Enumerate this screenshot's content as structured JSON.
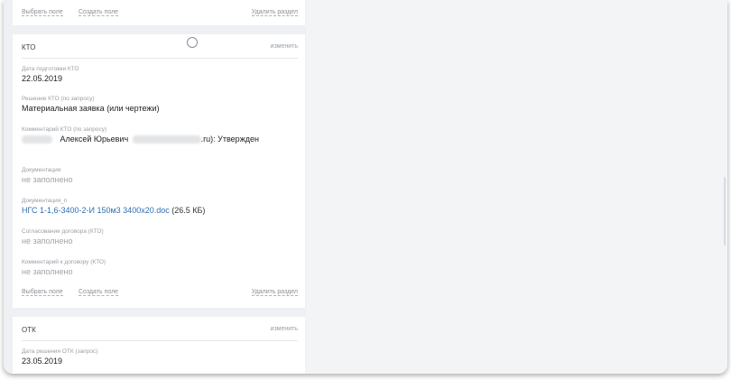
{
  "top_actions": {
    "select_field": "Выбрать поле",
    "create_field": "Создать поле",
    "delete_section": "Удалить раздел"
  },
  "kto": {
    "title": "КТО",
    "edit": "изменить",
    "prep_date_label": "Дата подготовки КТО",
    "prep_date": "22.05.2019",
    "decision_label": "Решение КТО (по запросу)",
    "decision": "Материальная заявка (или чертежи)",
    "comment_label": "Комментарий КТО (по запросу)",
    "comment_name": "Алексей Юрьевич",
    "comment_suffix": ".ru): Утвержден",
    "docs_label": "Документация",
    "docs_value": "не заполнено",
    "docs_n_label": "Документация_п",
    "docs_n_file": "НГС 1-1,6-3400-2-И 150м3 3400х20.doc",
    "docs_n_size": "(26.5 КБ)",
    "agreement_label": "Согласование договора (КТО)",
    "agreement_value": "не заполнено",
    "agreement_comment_label": "Комментарий к договору (КТО)",
    "agreement_comment_value": "не заполнено",
    "select_field": "Выбрать поле",
    "create_field": "Создать поле",
    "delete_section": "Удалить раздел"
  },
  "otk": {
    "title": "ОТК",
    "edit": "изменить",
    "decision_date_label": "Дата решения ОТК (запрос)",
    "decision_date": "23.05.2019"
  }
}
